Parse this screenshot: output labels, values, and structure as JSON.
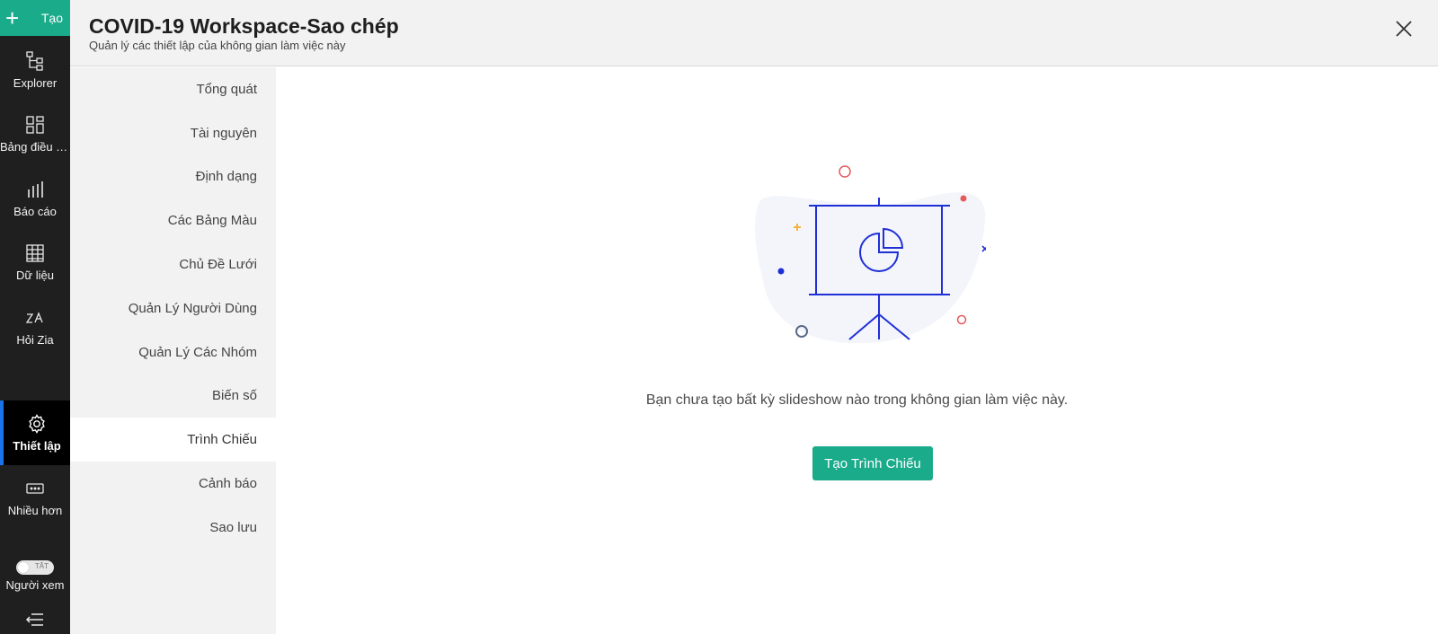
{
  "rail": {
    "create_label": "Tạo",
    "items": [
      {
        "label": "Explorer",
        "icon": "explorer-icon"
      },
      {
        "label": "Bảng điều k...",
        "icon": "dashboard-icon"
      },
      {
        "label": "Báo cáo",
        "icon": "reports-icon"
      },
      {
        "label": "Dữ liệu",
        "icon": "data-table-icon"
      },
      {
        "label": "Hỏi Zia",
        "icon": "zia-icon"
      },
      {
        "label": "Thiết lập",
        "icon": "gear-icon",
        "active": true
      },
      {
        "label": "Nhiều hơn",
        "icon": "more-icon"
      }
    ],
    "viewer_toggle": {
      "label": "Người xem",
      "state": "TẮT"
    }
  },
  "header": {
    "title": "COVID-19 Workspace-Sao chép",
    "subtitle": "Quản lý các thiết lập của không gian làm việc này"
  },
  "nav": {
    "items": [
      "Tổng quát",
      "Tài nguyên",
      "Định dạng",
      "Các Bảng Màu",
      "Chủ Đề Lưới",
      "Quản Lý Người Dùng",
      "Quản Lý Các Nhóm",
      "Biến số",
      "Trình Chiếu",
      "Cảnh báo",
      "Sao lưu"
    ],
    "active_index": 8
  },
  "main": {
    "empty_message": "Bạn chưa tạo bất kỳ slideshow nào trong không gian làm việc này.",
    "create_button": "Tạo Trình Chiếu",
    "illustration_icon": "presentation-board-icon"
  },
  "colors": {
    "accent": "#1aab8b",
    "rail_bg": "#1f1f1f",
    "active_indicator": "#1a73e8",
    "illustration_stroke": "#1f2fd6"
  }
}
